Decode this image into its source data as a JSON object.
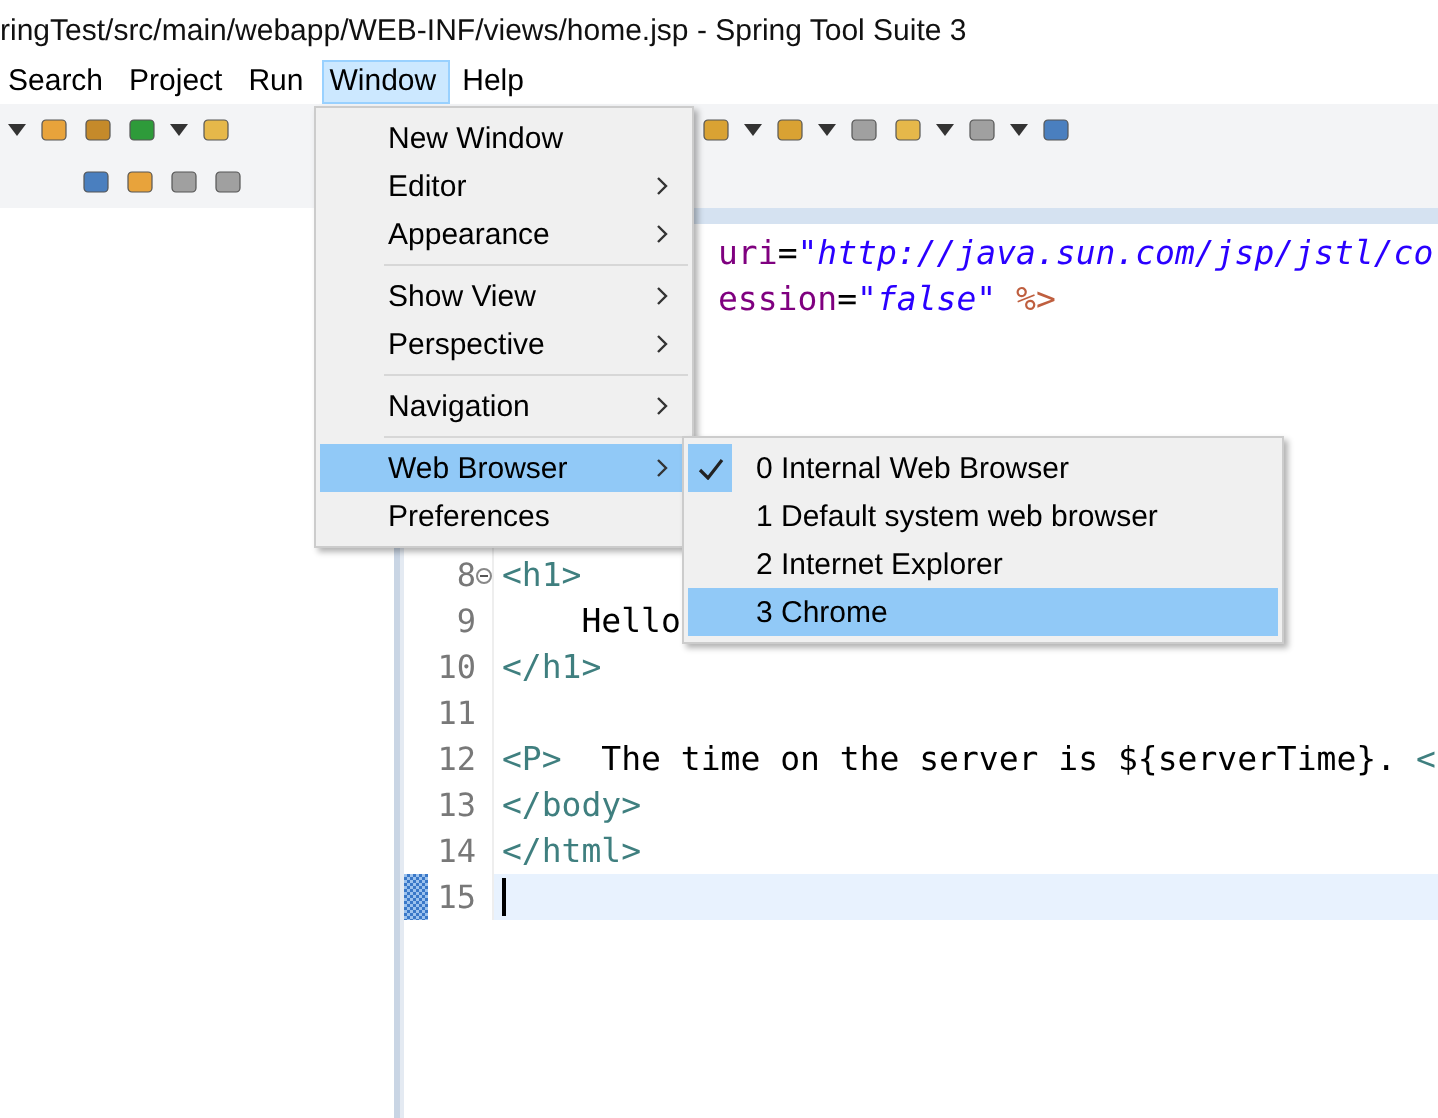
{
  "window": {
    "title": "ringTest/src/main/webapp/WEB-INF/views/home.jsp - Spring Tool Suite 3"
  },
  "menu_bar": [
    {
      "label": "Search",
      "selected": false
    },
    {
      "label": "Project",
      "selected": false
    },
    {
      "label": "Run",
      "selected": false
    },
    {
      "label": "Window",
      "selected": true
    },
    {
      "label": "Help",
      "selected": false
    }
  ],
  "window_menu": [
    {
      "kind": "item",
      "label": "New Window",
      "submenu": false,
      "selected": false
    },
    {
      "kind": "item",
      "label": "Editor",
      "submenu": true,
      "selected": false
    },
    {
      "kind": "item",
      "label": "Appearance",
      "submenu": true,
      "selected": false
    },
    {
      "kind": "separator"
    },
    {
      "kind": "item",
      "label": "Show View",
      "submenu": true,
      "selected": false
    },
    {
      "kind": "item",
      "label": "Perspective",
      "submenu": true,
      "selected": false
    },
    {
      "kind": "separator"
    },
    {
      "kind": "item",
      "label": "Navigation",
      "submenu": true,
      "selected": false
    },
    {
      "kind": "separator"
    },
    {
      "kind": "item",
      "label": "Web Browser",
      "submenu": true,
      "selected": true
    },
    {
      "kind": "item",
      "label": "Preferences",
      "submenu": false,
      "selected": false
    }
  ],
  "web_browser_submenu": [
    {
      "label": "0 Internal Web Browser",
      "checked": true,
      "selected": false
    },
    {
      "label": "1 Default system web browser",
      "checked": false,
      "selected": false
    },
    {
      "label": "2 Internet Explorer",
      "checked": false,
      "selected": false
    },
    {
      "label": "3 Chrome",
      "checked": false,
      "selected": true
    }
  ],
  "editor": {
    "lines": [
      {
        "kind": "covered",
        "segments": [
          {
            "kind": "attr",
            "text": "uri"
          },
          {
            "kind": "text",
            "text": "="
          },
          {
            "kind": "string",
            "text": "\"http://java.sun.com/jsp/jstl/co"
          }
        ]
      },
      {
        "kind": "covered",
        "segments": [
          {
            "kind": "attr",
            "text": "ession"
          },
          {
            "kind": "text",
            "text": "="
          },
          {
            "kind": "string",
            "text": "\"false\""
          },
          {
            "kind": "directive",
            "text": " %>"
          }
        ]
      },
      {
        "kind": "covered"
      },
      {
        "kind": "covered"
      },
      {
        "kind": "covered"
      },
      {
        "kind": "covered"
      },
      {
        "kind": "covered"
      },
      {
        "kind": "line",
        "number": "8",
        "folded": false,
        "segments": [
          {
            "kind": "tag",
            "text": "<h1>"
          }
        ]
      },
      {
        "kind": "line",
        "number": "9",
        "segments": [
          {
            "kind": "text",
            "text": "    Hello"
          }
        ]
      },
      {
        "kind": "line",
        "number": "10",
        "segments": [
          {
            "kind": "tag",
            "text": "</h1>"
          }
        ]
      },
      {
        "kind": "line",
        "number": "11"
      },
      {
        "kind": "line",
        "number": "12",
        "segments": [
          {
            "kind": "tag",
            "text": "<P>"
          },
          {
            "kind": "text",
            "text": "  The time on the server is ${serverTime}. "
          },
          {
            "kind": "tag",
            "text": "<"
          }
        ]
      },
      {
        "kind": "line",
        "number": "13",
        "segments": [
          {
            "kind": "tag",
            "text": "</body>"
          }
        ]
      },
      {
        "kind": "line",
        "number": "14",
        "segments": [
          {
            "kind": "tag",
            "text": "</html>"
          }
        ]
      },
      {
        "kind": "line",
        "number": "15",
        "current": true
      }
    ]
  }
}
